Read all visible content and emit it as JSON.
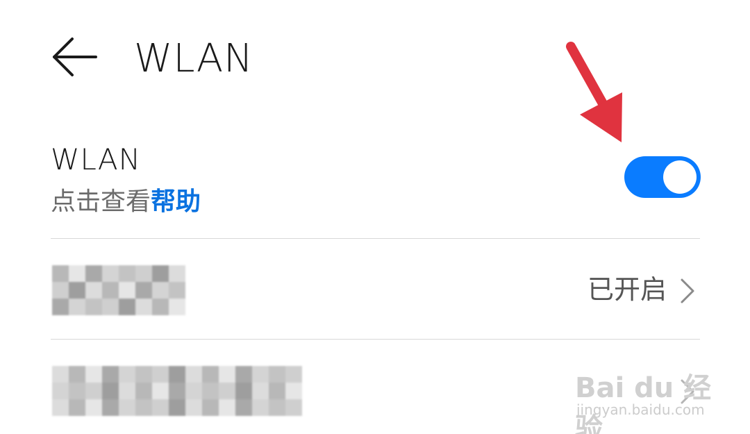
{
  "header": {
    "title": "WLAN",
    "back_icon": "arrow-left-icon"
  },
  "wlan_toggle_row": {
    "title": "WLAN",
    "subtitle_prefix": "点击查看",
    "help_link": "帮助",
    "toggle_on": true,
    "toggle_color": "#0a7cff"
  },
  "rows": [
    {
      "label": "(redacted)",
      "value": "已开启",
      "chevron_icon": "chevron-right-icon"
    },
    {
      "label": "(redacted)",
      "value": "",
      "chevron_icon": "chevron-right-icon"
    }
  ],
  "annotation": {
    "arrow_icon": "red-arrow-down-icon",
    "color": "#e0333f"
  },
  "watermark": {
    "logo_text": "Bai du 经验",
    "url": "jingyan.baidu.com"
  }
}
